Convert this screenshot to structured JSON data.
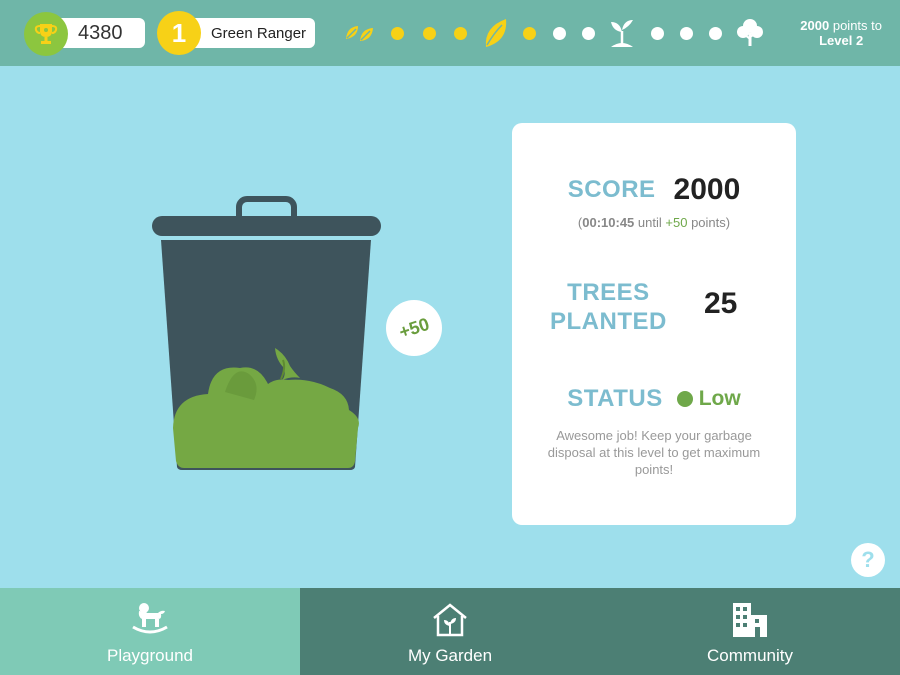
{
  "header": {
    "points_total": "4380",
    "rank_number": "1",
    "rank_title": "Green Ranger",
    "level_progress": {
      "steps": [
        "leaves-icon",
        "dot-yellow",
        "dot-yellow",
        "dot-yellow",
        "leaf-icon",
        "dot-yellow",
        "dot-white",
        "dot-white",
        "sprout-icon",
        "dot-white",
        "dot-white",
        "dot-white",
        "tree-icon"
      ],
      "completed_steps": 6
    },
    "next_level_points": "2000",
    "next_level_suffix": "points to",
    "next_level_name": "Level 2"
  },
  "bin": {
    "bonus_label": "+50"
  },
  "card": {
    "score_label": "SCORE",
    "score_value": "2000",
    "score_sub_open": "(",
    "score_timer": "00:10:45",
    "score_until": "until",
    "score_bonus": "+50",
    "score_sub_close": "points)",
    "trees_label_line1": "TREES",
    "trees_label_line2": "PLANTED",
    "trees_value": "25",
    "status_label": "STATUS",
    "status_value": "Low",
    "status_message": "Awesome job! Keep your garbage disposal at this level to get maximum points!"
  },
  "help": {
    "label": "?"
  },
  "nav": {
    "items": [
      {
        "label": "Playground",
        "icon": "rocking-horse-icon",
        "active": true
      },
      {
        "label": "My Garden",
        "icon": "garden-house-icon",
        "active": false
      },
      {
        "label": "Community",
        "icon": "buildings-icon",
        "active": false
      }
    ]
  },
  "colors": {
    "header_bg": "#6fb6a8",
    "page_bg": "#9edfec",
    "accent_yellow": "#f7d117",
    "accent_green": "#6fa84a",
    "nav_active": "#7fcab6",
    "nav_inactive": "#4c7f74",
    "bin_body": "#3e545c"
  }
}
